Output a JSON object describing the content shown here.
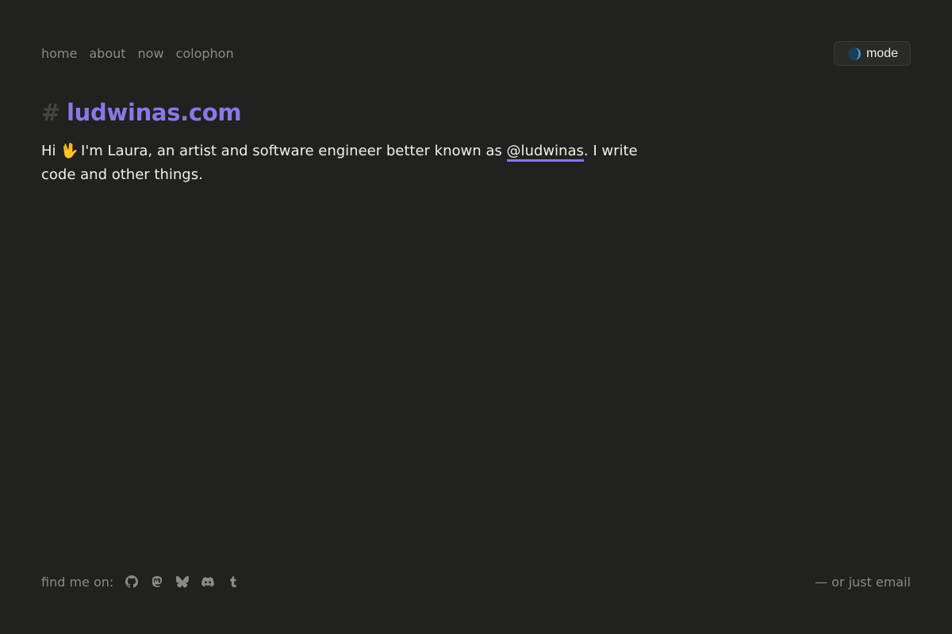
{
  "nav": {
    "items": [
      {
        "label": "home"
      },
      {
        "label": "about"
      },
      {
        "label": "now"
      },
      {
        "label": "colophon"
      }
    ]
  },
  "mode_button": {
    "label": "mode",
    "icon": "half-moon-icon"
  },
  "heading": {
    "hash": "#",
    "site": "ludwinas.com"
  },
  "intro": {
    "before_wave": "Hi",
    "wave": "🖖",
    "middle": " I'm Laura, an artist and software engineer better known as ",
    "handle": "@ludwinas",
    "after": ". I write code and other things."
  },
  "footer": {
    "find_label": "find me on:",
    "socials": [
      {
        "icon": "github-icon"
      },
      {
        "icon": "mastodon-icon"
      },
      {
        "icon": "bluesky-icon"
      },
      {
        "icon": "discord-icon"
      },
      {
        "icon": "tumblr-icon"
      }
    ],
    "email_label": "— or just email"
  },
  "colors": {
    "background": "#21211f",
    "text": "#f2efe6",
    "muted": "#8c8a84",
    "accent": "#8b77e8"
  }
}
